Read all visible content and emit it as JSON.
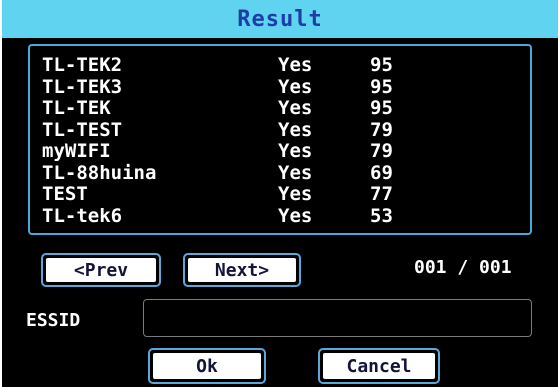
{
  "dialog": {
    "title": "Result"
  },
  "networks": [
    {
      "name": "TL-TEK2",
      "encrypted": "Yes",
      "signal": "95"
    },
    {
      "name": "TL-TEK3",
      "encrypted": "Yes",
      "signal": "95"
    },
    {
      "name": "TL-TEK",
      "encrypted": "Yes",
      "signal": "95"
    },
    {
      "name": "TL-TEST",
      "encrypted": "Yes",
      "signal": "79"
    },
    {
      "name": "myWIFI",
      "encrypted": "Yes",
      "signal": "79"
    },
    {
      "name": "TL-88huina",
      "encrypted": "Yes",
      "signal": "69"
    },
    {
      "name": "TEST",
      "encrypted": "Yes",
      "signal": "77"
    },
    {
      "name": "TL-tek6",
      "encrypted": "Yes",
      "signal": "53"
    }
  ],
  "pager": {
    "prev_label": "<Prev",
    "next_label": "Next>",
    "counter": "001 / 001"
  },
  "essid": {
    "label": "ESSID",
    "value": ""
  },
  "actions": {
    "ok_label": "Ok",
    "cancel_label": "Cancel"
  },
  "colors": {
    "title_bar": "#5fd3ef",
    "title_text": "#1b3fa6",
    "border": "#4aa8d8",
    "background": "#000000"
  }
}
